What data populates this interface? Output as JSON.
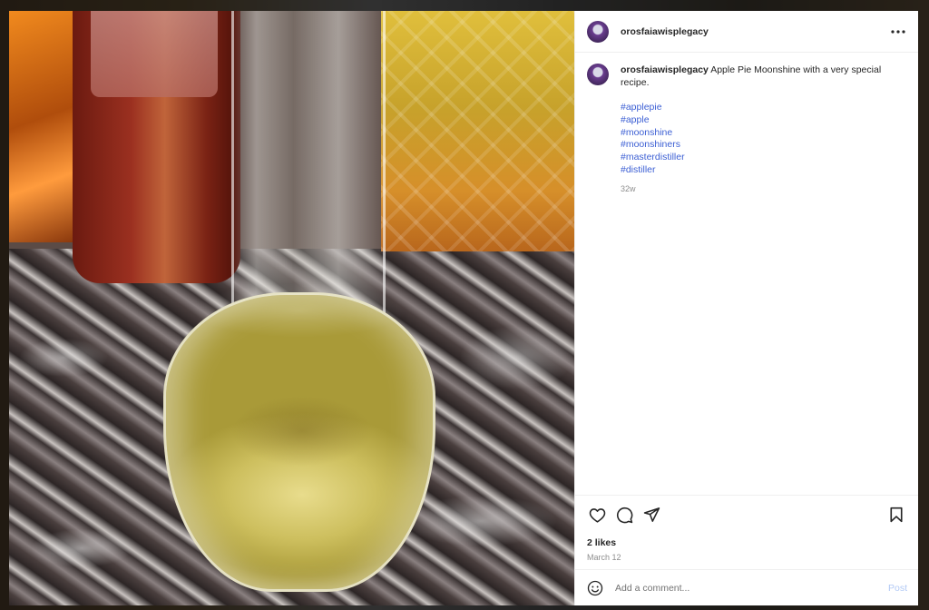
{
  "post": {
    "username": "orosfaiawisplegacy",
    "caption_text": "Apple Pie Moonshine with a very special recipe.",
    "hashtags": [
      "#applepie",
      "#apple",
      "#moonshine",
      "#moonshiners",
      "#masterdistiller",
      "#distiller"
    ],
    "caption_time": "32w",
    "likes": "2 likes",
    "date": "March 12"
  },
  "icons": {
    "more": "more-options-icon",
    "like": "heart-icon",
    "comment": "comment-icon",
    "share": "share-icon",
    "save": "bookmark-icon",
    "emoji": "emoji-icon"
  },
  "comment_box": {
    "placeholder": "Add a comment...",
    "post_label": "Post"
  },
  "colors": {
    "link": "#3c5fd4",
    "post_button_disabled": "#b2c9f5",
    "muted_text": "#8e8e8e"
  }
}
